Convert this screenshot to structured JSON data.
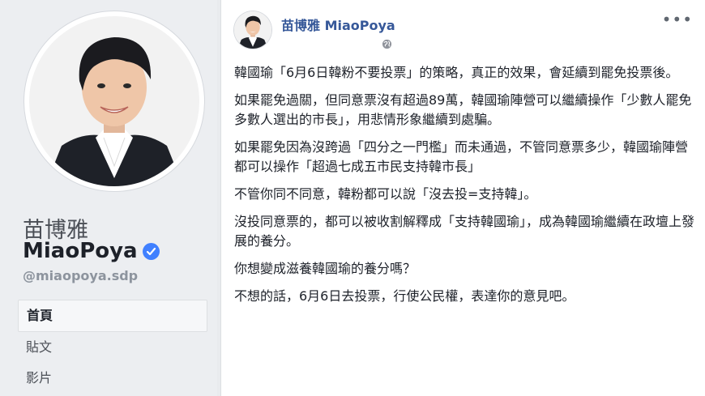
{
  "profile": {
    "name_zh": "苗博雅",
    "name_en": "MiaoPoya",
    "handle": "@miaopoya.sdp",
    "nav": [
      "首頁",
      "貼文",
      "影片"
    ]
  },
  "post": {
    "author": "苗博雅 MiaoPoya",
    "more_label": "•••",
    "paragraphs": [
      "韓國瑜「6月6日韓粉不要投票」的策略，真正的效果，會延續到罷免投票後。",
      "如果罷免過關，但同意票沒有超過89萬，韓國瑜陣營可以繼續操作「少數人罷免多數人選出的市長」，用悲情形象繼續到處騙。",
      "如果罷免因為沒跨過「四分之一門檻」而未通過，不管同意票多少，韓國瑜陣營都可以操作「超過七成五市民支持韓市長」",
      "不管你同不同意，韓粉都可以說「沒去投=支持韓」。",
      "沒投同意票的，都可以被收割解釋成「支持韓國瑜」，成為韓國瑜繼續在政壇上發展的養分。",
      "你想變成滋養韓國瑜的養分嗎？",
      "不想的話，6月6日去投票，行使公民權，表達你的意見吧。"
    ]
  },
  "colors": {
    "link": "#365899",
    "verified": "#4080ff"
  },
  "icons": [
    "verified-badge-icon",
    "globe-icon",
    "more-options-icon"
  ]
}
